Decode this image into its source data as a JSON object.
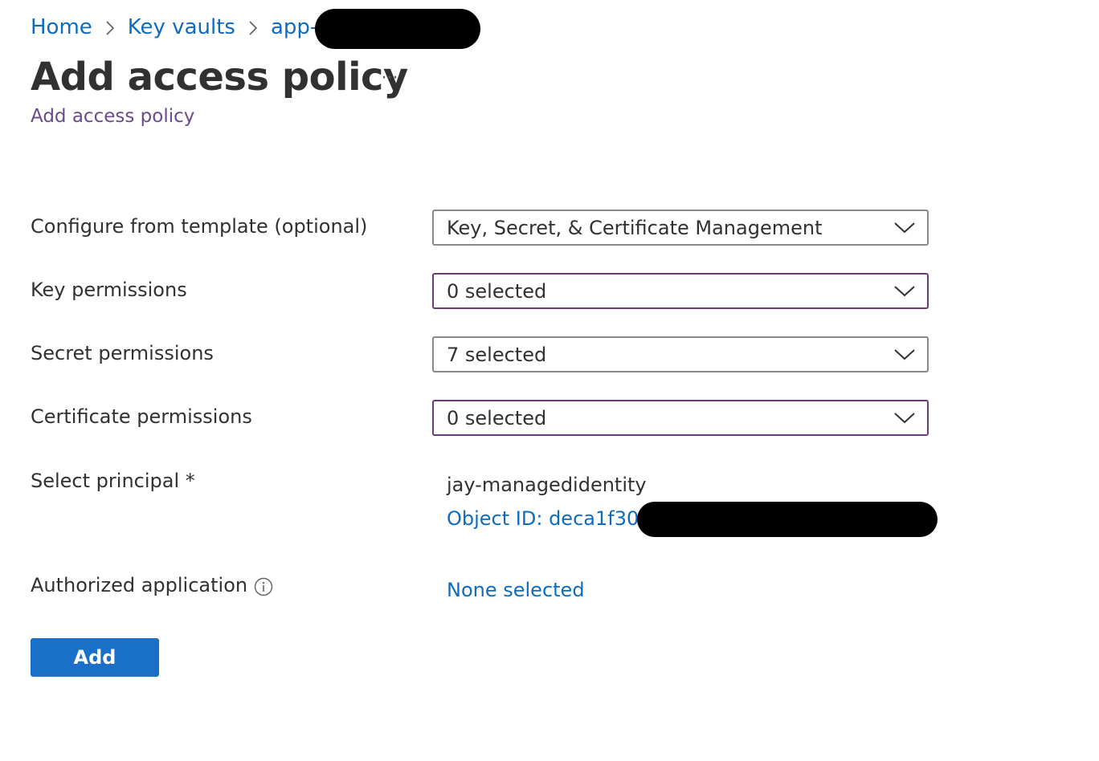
{
  "breadcrumb": {
    "items": [
      {
        "label": "Home"
      },
      {
        "label": "Key vaults"
      },
      {
        "label": "app-s"
      }
    ]
  },
  "page": {
    "title": "Add access policy",
    "more_icon": "ellipsis-icon",
    "more_label": "···",
    "subtitle": "Add access policy"
  },
  "form": {
    "template": {
      "label": "Configure from template (optional)",
      "value": "Key, Secret, & Certificate Management"
    },
    "key_permissions": {
      "label": "Key permissions",
      "value": "0 selected"
    },
    "secret_permissions": {
      "label": "Secret permissions",
      "value": "7 selected"
    },
    "certificate_permissions": {
      "label": "Certificate permissions",
      "value": "0 selected"
    },
    "principal": {
      "label": "Select principal *",
      "name": "jay-managedidentity",
      "object_id": "Object ID: deca1f30-("
    },
    "authorized_application": {
      "label": "Authorized application",
      "value": "None selected",
      "icon": "info-icon"
    },
    "add_button": "Add"
  },
  "colors": {
    "link": "#0f6cbd",
    "primary_button": "#1a6fc9",
    "subtitle": "#6b4a8a",
    "focused_border": "#6b3a7a"
  }
}
